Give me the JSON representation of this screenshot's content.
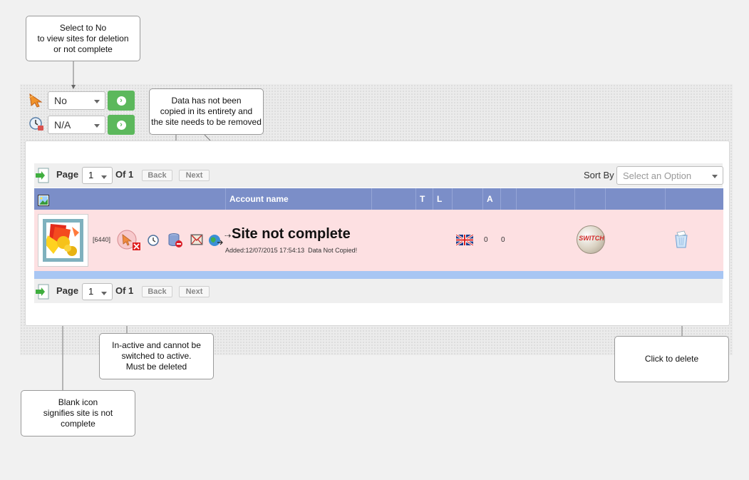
{
  "callouts": {
    "select_no": "Select to No\nto view sites for deletion\nor not complete",
    "data_not_copied": "Data has not been\ncopied in its entirety and\nthe site needs to be removed",
    "inactive": "In-active and cannot be\nswitched to active.\nMust be deleted",
    "blank_icon": "Blank icon\nsignifies site is not\ncomplete",
    "click_delete": "Click to delete"
  },
  "filters": {
    "status_value": "No",
    "time_value": "N/A",
    "go_glyph": "›"
  },
  "pager": {
    "page_label": "Page",
    "page_value": "1",
    "of_label": "Of 1",
    "back_label": "Back",
    "next_label": "Next"
  },
  "sort": {
    "label": "Sort By",
    "placeholder": "Select an Option"
  },
  "table": {
    "columns": [
      "",
      "Account name",
      "T",
      "L",
      "",
      "A",
      "",
      "",
      "",
      "",
      ""
    ]
  },
  "row": {
    "id": "[6440]",
    "title": "Site not complete",
    "added": "Added:12/07/2015 17:54:13  Data Not Copied!",
    "count_1": "0",
    "count_2": "0",
    "switch_label": "SWITCH"
  },
  "icons": {
    "status_filter": "pointer-icon",
    "time_filter": "clock-lock-icon",
    "pager": "page-arrow-icon",
    "header_image": "image-icon",
    "inactive": "inactive-pointer-icon",
    "clock": "clock-icon",
    "database": "database-remove-icon",
    "mail": "mail-icon",
    "globe": "globe-icon",
    "flag": "uk-flag-icon",
    "switch": "switch-icon",
    "delete": "trash-icon"
  },
  "colors": {
    "go_button": "#5cb85c",
    "header": "#7b8ec8",
    "row_background": "#fde0e2",
    "row_separator": "#a8c6f3"
  }
}
